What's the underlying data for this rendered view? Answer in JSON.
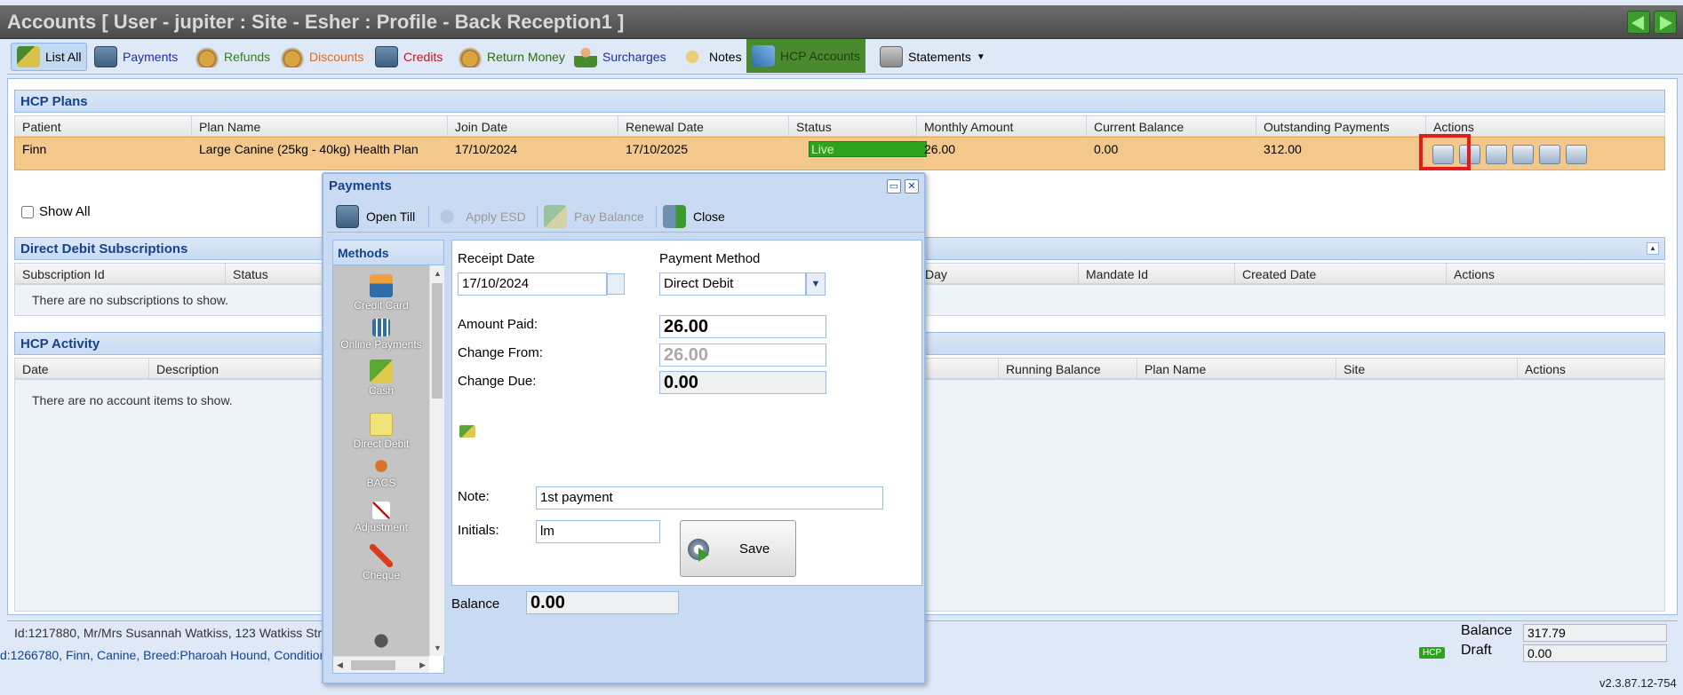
{
  "window": {
    "title": "Accounts [ User - jupiter : Site - Esher : Profile - Back Reception1 ]"
  },
  "toolbar": {
    "list_all": "List All",
    "payments": "Payments",
    "refunds": "Refunds",
    "discounts": "Discounts",
    "credits": "Credits",
    "return_money": "Return Money",
    "surcharges": "Surcharges",
    "notes": "Notes",
    "hcp_accounts": "HCP Accounts",
    "statements": "Statements"
  },
  "hcp_plans": {
    "title": "HCP Plans",
    "columns": [
      "Patient",
      "Plan Name",
      "Join Date",
      "Renewal Date",
      "Status",
      "Monthly Amount",
      "Current Balance",
      "Outstanding Payments",
      "Actions"
    ],
    "row": {
      "patient": "Finn",
      "plan_name": "Large Canine (25kg - 40kg) Health Plan",
      "join_date": "17/10/2024",
      "renewal_date": "17/10/2025",
      "status": "Live",
      "monthly_amount": "26.00",
      "current_balance": "0.00",
      "outstanding_payments": "312.00"
    }
  },
  "show_all": "Show All",
  "dd_subscriptions": {
    "title": "Direct Debit Subscriptions",
    "columns": [
      "Subscription Id",
      "Status",
      "Day",
      "Mandate Id",
      "Created Date",
      "Actions"
    ],
    "empty": "There are no subscriptions to show."
  },
  "hcp_activity": {
    "title": "HCP Activity",
    "columns": [
      "Date",
      "Description",
      "Running Balance",
      "Plan Name",
      "Site",
      "Actions"
    ],
    "empty": "There are no account items to show."
  },
  "footer": {
    "client": "Id:1217880, Mr/Mrs Susannah Watkiss, 123 Watkiss Stre",
    "patient": "d:1266780, Finn, Canine, Breed:Pharoah Hound, Condition:",
    "hcp_badge": "HCP",
    "balance_label": "Balance",
    "balance_value": "317.79",
    "draft_label": "Draft",
    "draft_value": "0.00",
    "version": "v2.3.87.12-754"
  },
  "payments_dialog": {
    "title": "Payments",
    "toolbar": {
      "open_till": "Open Till",
      "apply_esd": "Apply ESD",
      "pay_balance": "Pay Balance",
      "close": "Close"
    },
    "methods_title": "Methods",
    "methods": [
      "Credit Card",
      "Online Payments",
      "Cash",
      "Direct Debit",
      "BACS",
      "Adjustment",
      "Cheque"
    ],
    "receipt_date_label": "Receipt Date",
    "receipt_date": "17/10/2024",
    "payment_method_label": "Payment Method",
    "payment_method": "Direct Debit",
    "amount_paid_label": "Amount Paid:",
    "amount_paid": "26.00",
    "change_from_label": "Change From:",
    "change_from": "26.00",
    "change_due_label": "Change Due:",
    "change_due": "0.00",
    "note_label": "Note:",
    "note": "1st payment",
    "initials_label": "Initials:",
    "initials": "lm",
    "save": "Save",
    "balance_label": "Balance",
    "balance": "0.00"
  }
}
